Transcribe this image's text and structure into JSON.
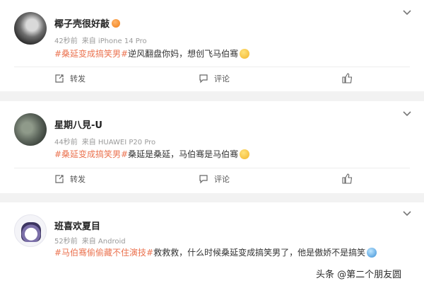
{
  "posts": [
    {
      "name": "椰子壳很好敲",
      "time": "42秒前",
      "source": "来自 iPhone 14 Pro",
      "topic": "#桑延变成搞笑男#",
      "text": "逆风翻盘你妈，想创飞马伯骞",
      "actions": {
        "repost": "转发",
        "comment": "评论"
      }
    },
    {
      "name": "星期八見-U",
      "time": "44秒前",
      "source": "来自 HUAWEI P20 Pro",
      "topic": "#桑延变成搞笑男#",
      "text": "桑延是桑延，马伯骞是马伯骞",
      "actions": {
        "repost": "转发",
        "comment": "评论"
      }
    },
    {
      "name": "班喜欢夏目",
      "time": "52秒前",
      "source": "来自 Android",
      "topic": "#马伯骞偷偷藏不住演技#",
      "text": "救救救，什么时候桑延变成搞笑男了，他是傲娇不是搞笑"
    }
  ],
  "watermark": "头条 @第二个朋友圆",
  "colors": {
    "topic": "#eb7350",
    "background": "#f2f2f2"
  }
}
